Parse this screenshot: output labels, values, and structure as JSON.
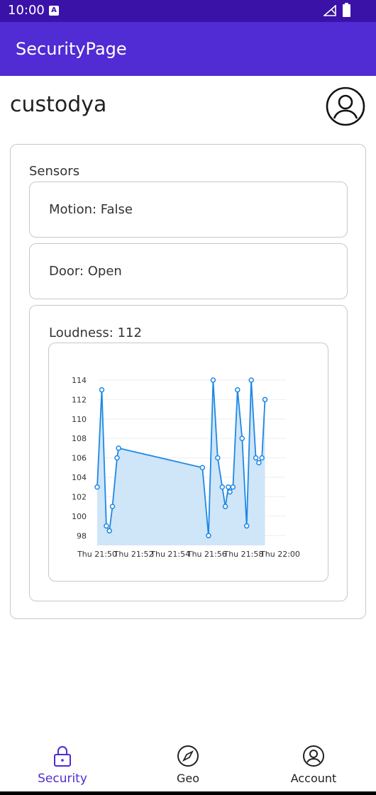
{
  "status_bar": {
    "time": "10:00",
    "notification_icon": "A"
  },
  "app_bar": {
    "title": "SecurityPage"
  },
  "user": {
    "name": "custodya"
  },
  "sensors": {
    "label": "Sensors",
    "motion": "Motion: False",
    "door": "Door: Open",
    "loudness": "Loudness: 112"
  },
  "colors": {
    "status_bar": "#3a12a8",
    "app_bar": "#512bd4",
    "nav_active": "#512bd4",
    "chart_line": "#1e88e5",
    "chart_fill": "#cfe5f8"
  },
  "chart_data": {
    "type": "area",
    "x": [
      "21:50:00",
      "21:50:15",
      "21:50:30",
      "21:50:40",
      "21:50:50",
      "21:51:05",
      "21:51:10",
      "21:55:45",
      "21:56:05",
      "21:56:20",
      "21:56:35",
      "21:56:50",
      "21:57:00",
      "21:57:10",
      "21:57:15",
      "21:57:25",
      "21:57:40",
      "21:57:55",
      "21:58:10",
      "21:58:25",
      "21:58:40",
      "21:58:50",
      "21:59:00",
      "21:59:10"
    ],
    "values": [
      103,
      113,
      99,
      98.5,
      101,
      106,
      107,
      105,
      98,
      114,
      106,
      103,
      101,
      103,
      102.5,
      103,
      113,
      108,
      99,
      114,
      106,
      105.5,
      106,
      112
    ],
    "ylim": [
      97,
      114
    ],
    "yticks": [
      "98",
      "100",
      "102",
      "104",
      "106",
      "108",
      "110",
      "112",
      "114"
    ],
    "xticks": [
      "Thu 21:50",
      "Thu 21:52",
      "Thu 21:54",
      "Thu 21:56",
      "Thu 21:58",
      "Thu 22:00"
    ],
    "grid": true
  },
  "nav": {
    "items": [
      {
        "label": "Security",
        "icon": "lock-icon"
      },
      {
        "label": "Geo",
        "icon": "compass-icon"
      },
      {
        "label": "Account",
        "icon": "account-icon"
      }
    ]
  }
}
